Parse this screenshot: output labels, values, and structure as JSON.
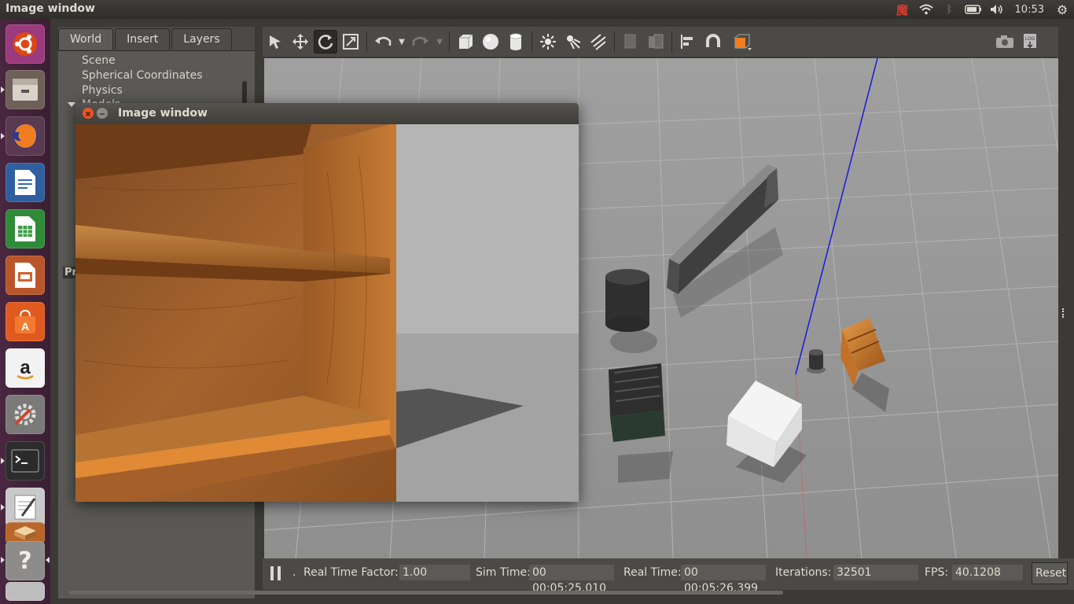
{
  "top_panel": {
    "title": "Image window",
    "clock": "10:53",
    "tray_icons": [
      "keyboard-input-icon",
      "wifi-icon",
      "bluetooth-icon",
      "battery-icon",
      "volume-icon",
      "settings-gear-icon"
    ]
  },
  "launcher": {
    "apps": [
      "ubuntu-dash",
      "files",
      "firefox",
      "libreoffice-writer",
      "libreoffice-calc",
      "libreoffice-impress",
      "ubuntu-software",
      "amazon",
      "system-settings",
      "terminal",
      "text-editor",
      "storage",
      "help"
    ]
  },
  "gazebo": {
    "tabs": [
      "World",
      "Insert",
      "Layers"
    ],
    "tree_items": [
      "Scene",
      "Spherical Coordinates",
      "Physics"
    ],
    "tree_partial": "Models",
    "props_partial": "Pr",
    "stats": {
      "rtf_label": "Real Time Factor:",
      "rtf_value": "1.00",
      "sim_label": "Sim Time:",
      "sim_value": "00 00:05:25.010",
      "real_label": "Real Time:",
      "real_value": "00 00:05:26.399",
      "iter_label": "Iterations:",
      "iter_value": "32501",
      "fps_label": "FPS:",
      "fps_value": "40.1208",
      "reset_label": "Reset",
      "step_marker": "."
    }
  },
  "image_window": {
    "title": "Image window"
  },
  "colors": {
    "launcher_bg": "#4a2740",
    "close_button": "#e95420",
    "accent_orange": "#f07d21"
  }
}
